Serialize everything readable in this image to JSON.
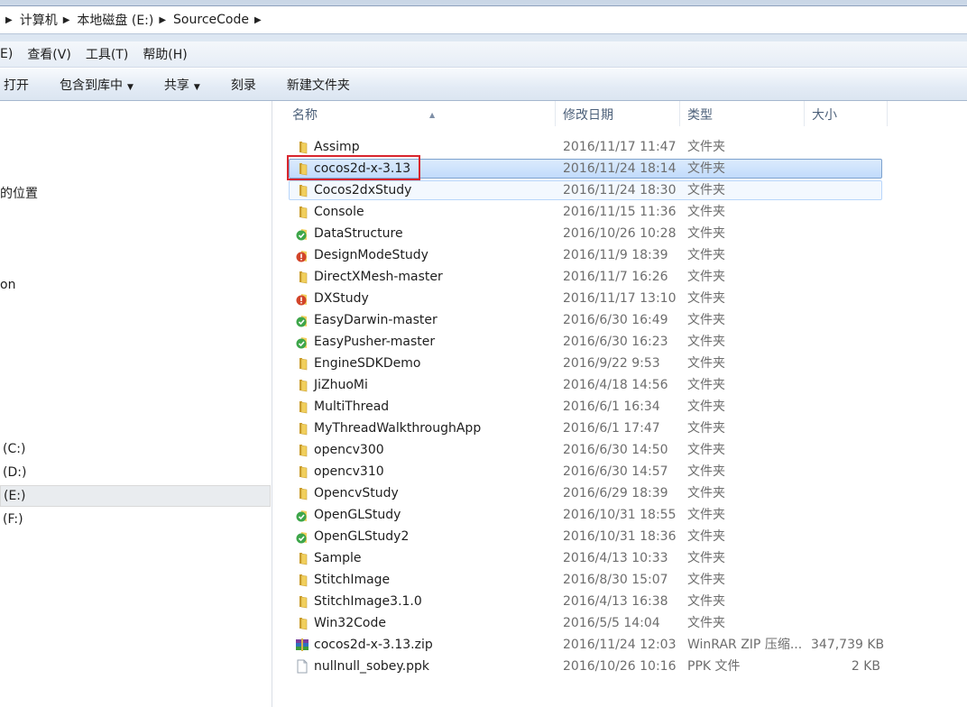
{
  "breadcrumb": [
    "计算机",
    "本地磁盘 (E:)",
    "SourceCode"
  ],
  "menu": [
    "E)",
    "查看(V)",
    "工具(T)",
    "帮助(H)"
  ],
  "toolbar": {
    "open": "打开",
    "include": "包含到库中",
    "share": "共享",
    "burn": "刻录",
    "new_folder": "新建文件夹"
  },
  "nav": {
    "places": "的位置",
    "on": "on",
    "drive_c": "(C:)",
    "drive_d": "(D:)",
    "drive_e": "(E:)",
    "drive_f": "(F:)"
  },
  "columns": {
    "name": "名称",
    "date": "修改日期",
    "type": "类型",
    "size": "大小"
  },
  "files": [
    {
      "name": "Assimp",
      "date": "2016/11/17 11:47",
      "type": "文件夹",
      "size": "",
      "icon": "folder-icon"
    },
    {
      "name": "cocos2d-x-3.13",
      "date": "2016/11/24 18:14",
      "type": "文件夹",
      "size": "",
      "icon": "folder-icon",
      "state": "selected"
    },
    {
      "name": "Cocos2dxStudy",
      "date": "2016/11/24 18:30",
      "type": "文件夹",
      "size": "",
      "icon": "folder-icon",
      "state": "hover"
    },
    {
      "name": "Console",
      "date": "2016/11/15 11:36",
      "type": "文件夹",
      "size": "",
      "icon": "folder-icon"
    },
    {
      "name": "DataStructure",
      "date": "2016/10/26 10:28",
      "type": "文件夹",
      "size": "",
      "icon": "svn-ok-folder-icon"
    },
    {
      "name": "DesignModeStudy",
      "date": "2016/11/9 18:39",
      "type": "文件夹",
      "size": "",
      "icon": "svn-modified-folder-icon"
    },
    {
      "name": "DirectXMesh-master",
      "date": "2016/11/7 16:26",
      "type": "文件夹",
      "size": "",
      "icon": "folder-icon"
    },
    {
      "name": "DXStudy",
      "date": "2016/11/17 13:10",
      "type": "文件夹",
      "size": "",
      "icon": "svn-modified-folder-icon"
    },
    {
      "name": "EasyDarwin-master",
      "date": "2016/6/30 16:49",
      "type": "文件夹",
      "size": "",
      "icon": "svn-ok-folder-icon"
    },
    {
      "name": "EasyPusher-master",
      "date": "2016/6/30 16:23",
      "type": "文件夹",
      "size": "",
      "icon": "svn-ok-folder-icon"
    },
    {
      "name": "EngineSDKDemo",
      "date": "2016/9/22 9:53",
      "type": "文件夹",
      "size": "",
      "icon": "folder-icon"
    },
    {
      "name": "JiZhuoMi",
      "date": "2016/4/18 14:56",
      "type": "文件夹",
      "size": "",
      "icon": "folder-icon"
    },
    {
      "name": "MultiThread",
      "date": "2016/6/1 16:34",
      "type": "文件夹",
      "size": "",
      "icon": "folder-icon"
    },
    {
      "name": "MyThreadWalkthroughApp",
      "date": "2016/6/1 17:47",
      "type": "文件夹",
      "size": "",
      "icon": "folder-icon"
    },
    {
      "name": "opencv300",
      "date": "2016/6/30 14:50",
      "type": "文件夹",
      "size": "",
      "icon": "folder-icon"
    },
    {
      "name": "opencv310",
      "date": "2016/6/30 14:57",
      "type": "文件夹",
      "size": "",
      "icon": "folder-icon"
    },
    {
      "name": "OpencvStudy",
      "date": "2016/6/29 18:39",
      "type": "文件夹",
      "size": "",
      "icon": "folder-icon"
    },
    {
      "name": "OpenGLStudy",
      "date": "2016/10/31 18:55",
      "type": "文件夹",
      "size": "",
      "icon": "svn-ok-folder-icon"
    },
    {
      "name": "OpenGLStudy2",
      "date": "2016/10/31 18:36",
      "type": "文件夹",
      "size": "",
      "icon": "svn-ok-folder-icon"
    },
    {
      "name": "Sample",
      "date": "2016/4/13 10:33",
      "type": "文件夹",
      "size": "",
      "icon": "folder-icon"
    },
    {
      "name": "StitchImage",
      "date": "2016/8/30 15:07",
      "type": "文件夹",
      "size": "",
      "icon": "folder-icon"
    },
    {
      "name": "StitchImage3.1.0",
      "date": "2016/4/13 16:38",
      "type": "文件夹",
      "size": "",
      "icon": "folder-icon"
    },
    {
      "name": "Win32Code",
      "date": "2016/5/5 14:04",
      "type": "文件夹",
      "size": "",
      "icon": "folder-icon"
    },
    {
      "name": "cocos2d-x-3.13.zip",
      "date": "2016/11/24 12:03",
      "type": "WinRAR ZIP 压缩...",
      "size": "347,739 KB",
      "icon": "winrar-archive-icon"
    },
    {
      "name": "nullnull_sobey.ppk",
      "date": "2016/10/26 10:16",
      "type": "PPK 文件",
      "size": "2 KB",
      "icon": "document-icon"
    }
  ],
  "colors": {
    "selection": "#c1dbfc",
    "highlight_box": "#d9262e",
    "folder": "#e8c14f"
  }
}
